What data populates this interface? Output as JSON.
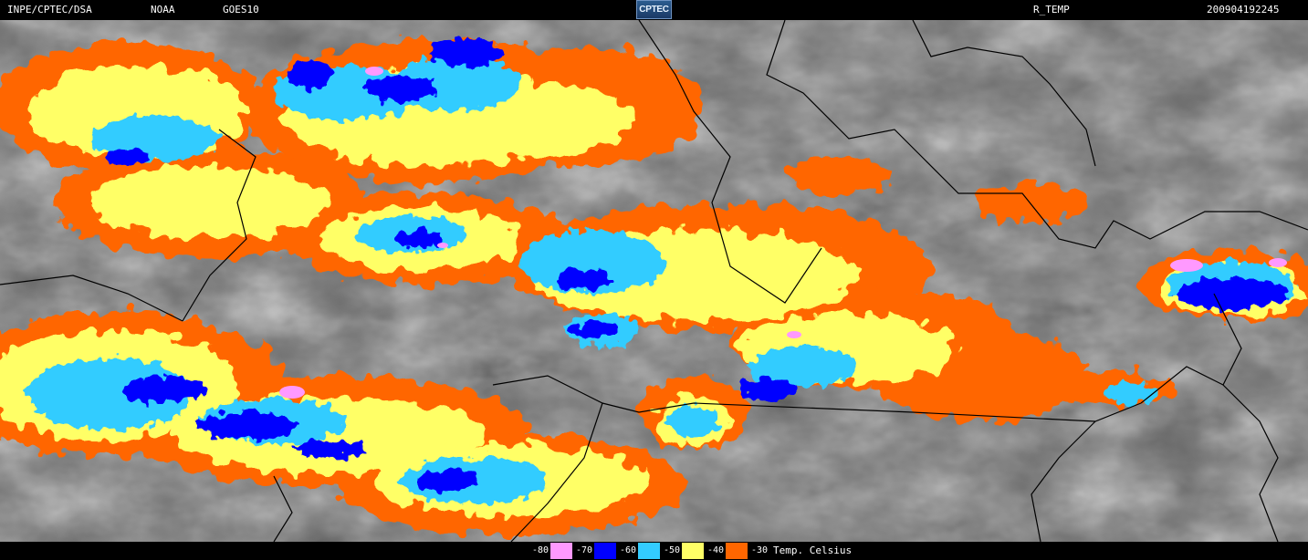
{
  "header": {
    "source": "INPE/CPTEC/DSA",
    "agency": "NOAA",
    "satellite": "GOES10",
    "logo_text": "CPTEC",
    "product": "R_TEMP",
    "timestamp": "200904192245"
  },
  "colors": {
    "background_gray": "#6e6e6e",
    "border_lines": "#000000",
    "temp_minus_80": "#ff99ff",
    "temp_minus_70": "#0000ff",
    "temp_minus_60": "#33ccff",
    "temp_minus_50": "#ffff66",
    "temp_minus_40": "#ff6600",
    "temp_minus_30": "#000000"
  },
  "legend": {
    "items": [
      {
        "label": "-80",
        "color": "#ff99ff"
      },
      {
        "label": "-70",
        "color": "#0000ff"
      },
      {
        "label": "-60",
        "color": "#33ccff"
      },
      {
        "label": "-50",
        "color": "#ffff66"
      },
      {
        "label": "-40",
        "color": "#ff6600"
      },
      {
        "label": "-30",
        "color": "#000000"
      }
    ],
    "unit": "Temp. Celsius"
  }
}
